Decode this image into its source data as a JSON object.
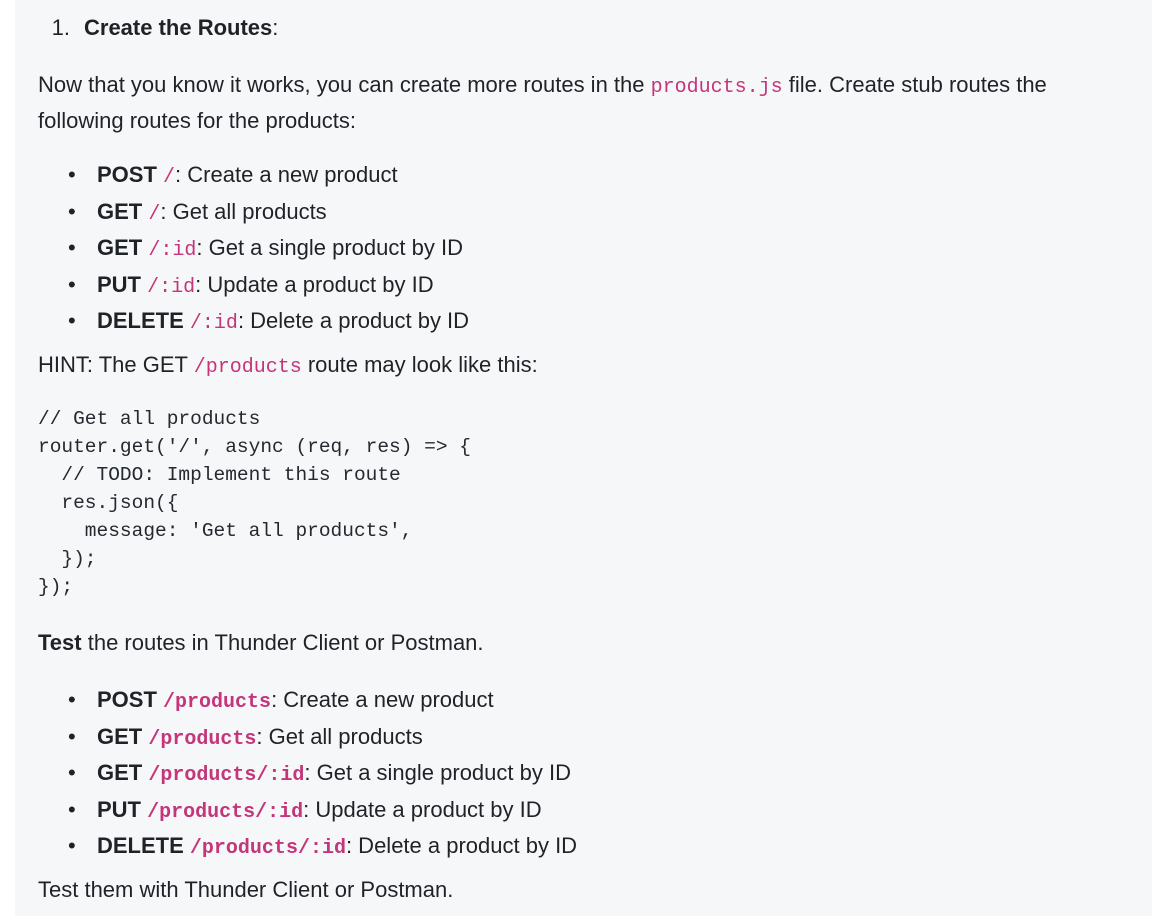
{
  "step": {
    "number": "1.",
    "title": "Create the Routes",
    "suffix": ":"
  },
  "intro": {
    "before": "Now that you know it works, you can create more routes in the ",
    "file": "products.js",
    "after": " file. Create stub routes the following routes for the products:"
  },
  "stub_routes": [
    {
      "method": "POST",
      "path": "/",
      "desc": ": Create a new product"
    },
    {
      "method": "GET",
      "path": "/",
      "desc": ": Get all products"
    },
    {
      "method": "GET",
      "path": "/:id",
      "desc": ": Get a single product by ID"
    },
    {
      "method": "PUT",
      "path": "/:id",
      "desc": ": Update a product by ID"
    },
    {
      "method": "DELETE",
      "path": "/:id",
      "desc": ": Delete a product by ID"
    }
  ],
  "hint": {
    "before": "HINT: The GET ",
    "path": "/products",
    "after": " route may look like this:"
  },
  "code_snippet": "// Get all products\nrouter.get('/', async (req, res) => {\n  // TODO: Implement this route\n  res.json({\n    message: 'Get all products',\n  });\n});",
  "test_intro": {
    "bold": "Test",
    "rest": " the routes in Thunder Client or Postman."
  },
  "test_routes": [
    {
      "method": "POST",
      "path": "/products",
      "desc": ": Create a new product"
    },
    {
      "method": "GET",
      "path": "/products",
      "desc": ": Get all products"
    },
    {
      "method": "GET",
      "path": "/products/:id",
      "desc": ": Get a single product by ID"
    },
    {
      "method": "PUT",
      "path": "/products/:id",
      "desc": ": Update a product by ID"
    },
    {
      "method": "DELETE",
      "path": "/products/:id",
      "desc": ": Delete a product by ID"
    }
  ],
  "closing": "Test them with Thunder Client or Postman.",
  "bullet_glyph": "•",
  "colors": {
    "inline_code": "#c4357a",
    "panel_bg": "#f6f7f9",
    "text": "#1f2328"
  }
}
